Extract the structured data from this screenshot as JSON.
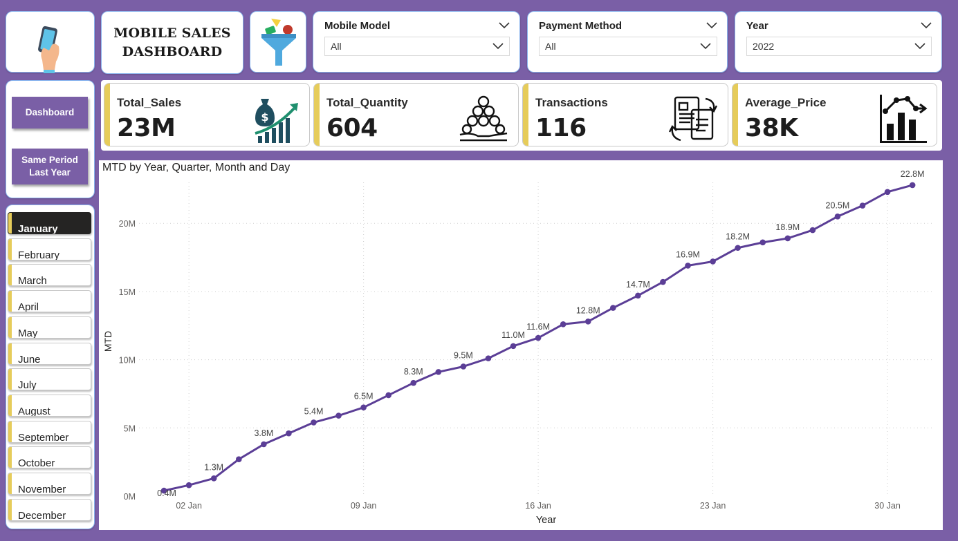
{
  "header": {
    "title_line1": "MOBILE SALES",
    "title_line2": "DASHBOARD"
  },
  "slicers": [
    {
      "label": "Mobile Model",
      "value": "All"
    },
    {
      "label": "Payment Method",
      "value": "All"
    },
    {
      "label": "Year",
      "value": "2022"
    }
  ],
  "nav": {
    "dashboard": "Dashboard",
    "spl_line1": "Same Period",
    "spl_line2": "Last Year"
  },
  "kpis": [
    {
      "label": "Total_Sales",
      "value": "23M",
      "icon": "money-bag-growth-icon"
    },
    {
      "label": "Total_Quantity",
      "value": "604",
      "icon": "coins-hand-icon"
    },
    {
      "label": "Transactions",
      "value": "116",
      "icon": "invoice-exchange-icon"
    },
    {
      "label": "Average_Price",
      "value": "38K",
      "icon": "bar-line-chart-icon"
    }
  ],
  "months": [
    "January",
    "February",
    "March",
    "April",
    "May",
    "June",
    "July",
    "August",
    "September",
    "October",
    "November",
    "December"
  ],
  "active_month": "January",
  "colors": {
    "accent": "#7a5fa6",
    "line": "#5b3e96",
    "kpi_accent": "#e6cc5a"
  },
  "chart_data": {
    "type": "line",
    "title": "MTD by Year, Quarter, Month and Day",
    "xlabel": "Year",
    "ylabel": "MTD",
    "x": [
      1,
      2,
      3,
      4,
      5,
      6,
      7,
      8,
      9,
      10,
      11,
      12,
      13,
      14,
      15,
      16,
      17,
      18,
      19,
      20,
      21,
      22,
      23,
      24,
      25,
      26,
      27,
      28,
      29,
      30,
      31
    ],
    "x_ticks": [
      {
        "day": 2,
        "label": "02 Jan"
      },
      {
        "day": 9,
        "label": "09 Jan"
      },
      {
        "day": 16,
        "label": "16 Jan"
      },
      {
        "day": 23,
        "label": "23 Jan"
      },
      {
        "day": 30,
        "label": "30 Jan"
      }
    ],
    "ylim": [
      0,
      23
    ],
    "y_ticks": [
      {
        "v": 0,
        "label": "0M"
      },
      {
        "v": 5,
        "label": "5M"
      },
      {
        "v": 10,
        "label": "10M"
      },
      {
        "v": 15,
        "label": "15M"
      },
      {
        "v": 20,
        "label": "20M"
      }
    ],
    "values": [
      0.4,
      0.8,
      1.3,
      2.7,
      3.8,
      4.6,
      5.4,
      5.9,
      6.5,
      7.4,
      8.3,
      9.1,
      9.5,
      10.1,
      11.0,
      11.6,
      12.6,
      12.8,
      13.8,
      14.7,
      15.7,
      16.9,
      17.2,
      18.2,
      18.6,
      18.9,
      19.5,
      20.5,
      21.3,
      22.3,
      22.8
    ],
    "data_labels": [
      {
        "i": 0,
        "t": "0.4M"
      },
      {
        "i": 2,
        "t": "1.3M"
      },
      {
        "i": 4,
        "t": "3.8M"
      },
      {
        "i": 6,
        "t": "5.4M"
      },
      {
        "i": 8,
        "t": "6.5M"
      },
      {
        "i": 10,
        "t": "8.3M"
      },
      {
        "i": 12,
        "t": "9.5M"
      },
      {
        "i": 14,
        "t": "11.0M"
      },
      {
        "i": 15,
        "t": "11.6M"
      },
      {
        "i": 17,
        "t": "12.8M"
      },
      {
        "i": 19,
        "t": "14.7M"
      },
      {
        "i": 21,
        "t": "16.9M"
      },
      {
        "i": 23,
        "t": "18.2M"
      },
      {
        "i": 25,
        "t": "18.9M"
      },
      {
        "i": 27,
        "t": "20.5M"
      },
      {
        "i": 30,
        "t": "22.8M"
      }
    ],
    "grid": true,
    "legend": "none"
  }
}
